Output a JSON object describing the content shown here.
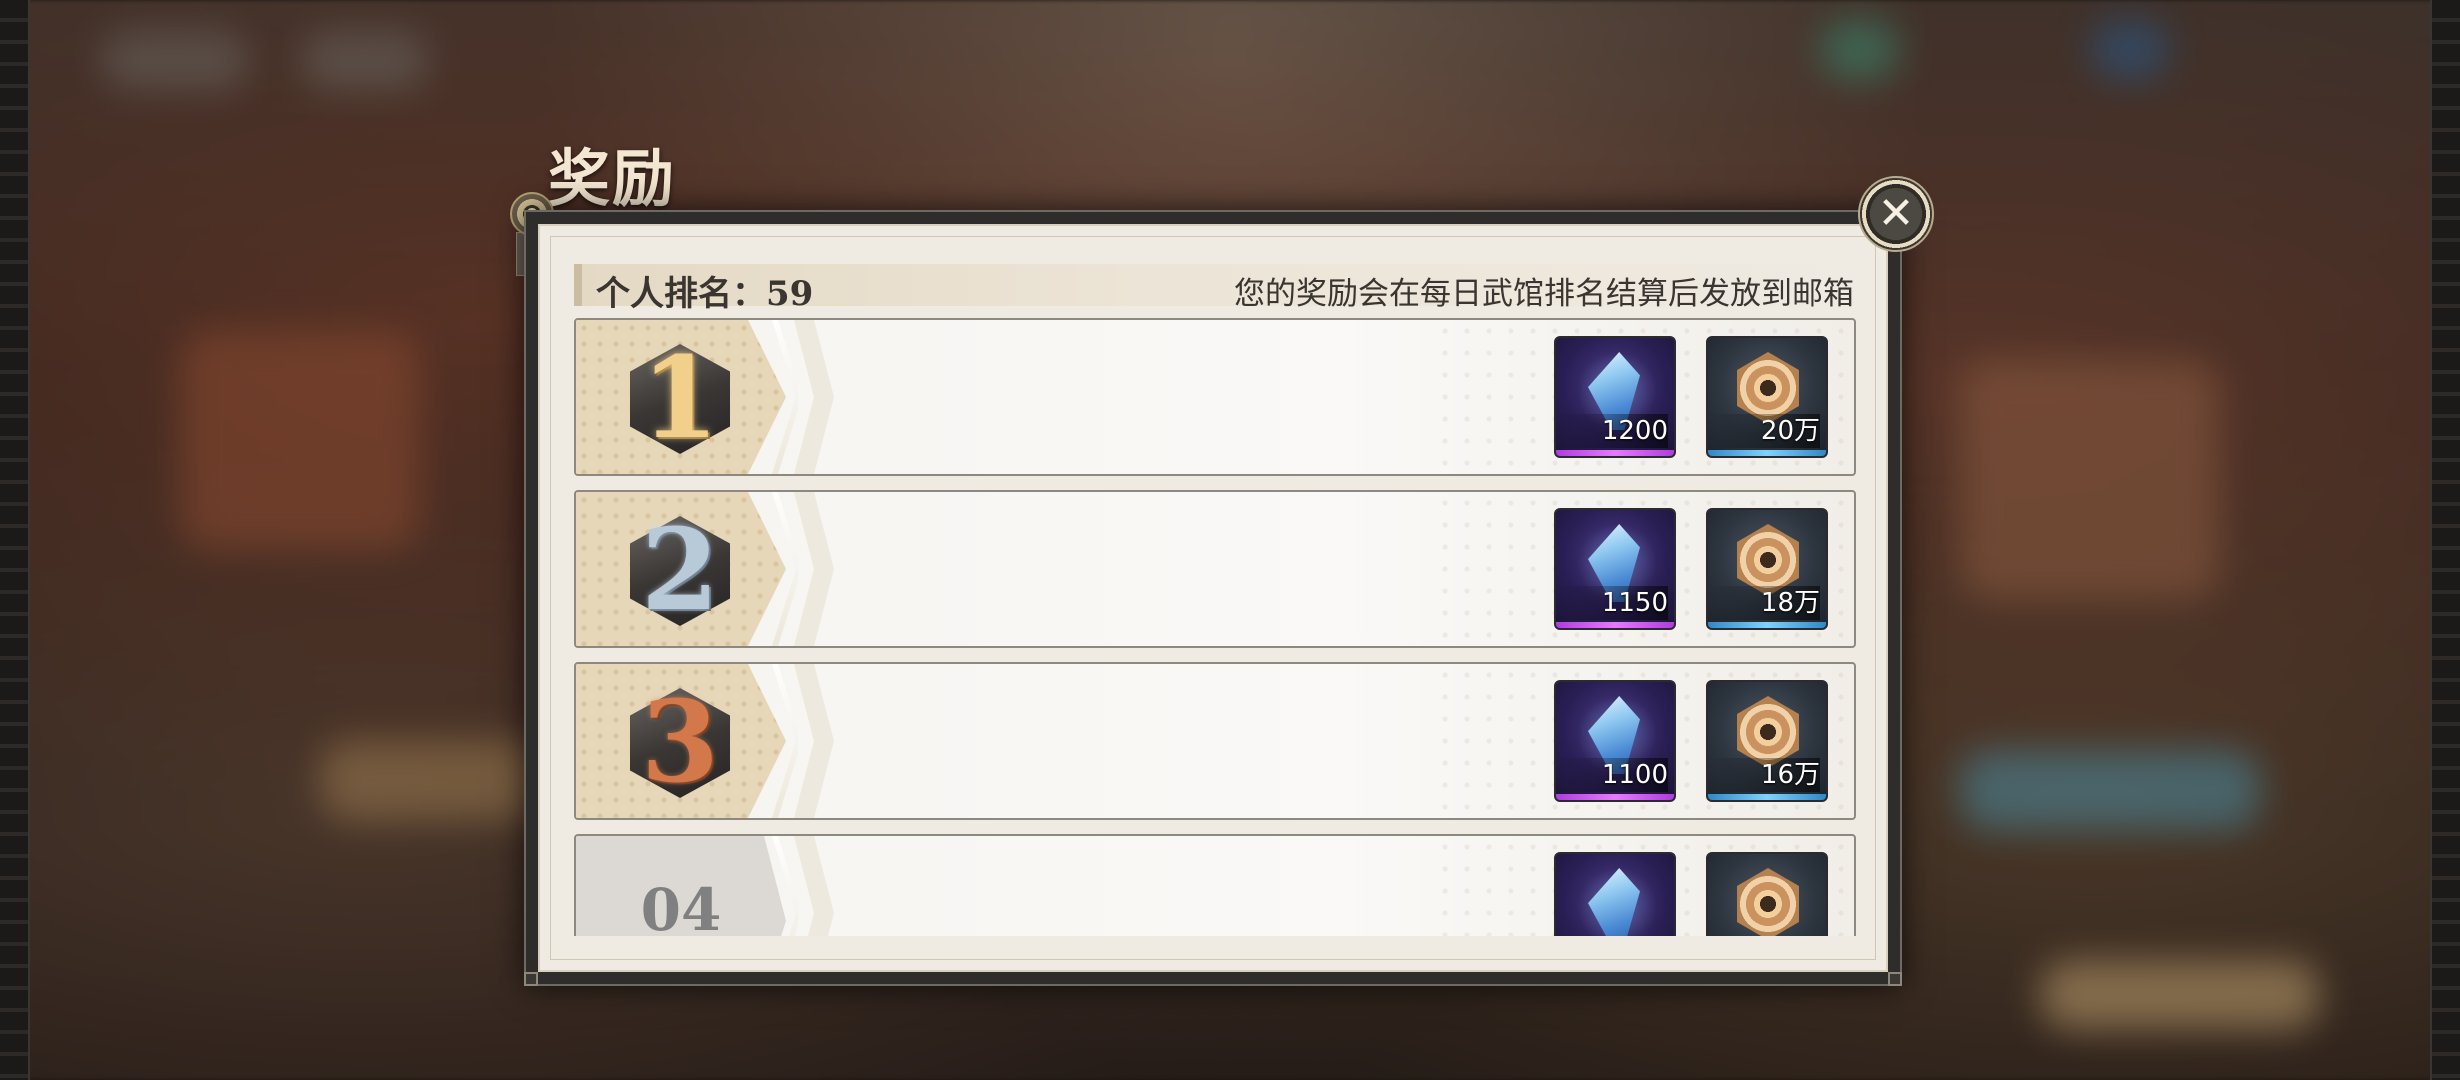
{
  "dialog": {
    "title": "奖励",
    "close_icon": "close-icon"
  },
  "header": {
    "rank_label": "个人排名：59",
    "note": "您的奖励会在每日武馆排名结算后发放到邮箱"
  },
  "rewards": [
    {
      "rank": "1",
      "medal": "gold",
      "items": [
        {
          "icon": "feather-crystal-icon",
          "qty": "1200"
        },
        {
          "icon": "gold-coin-icon",
          "qty": "20万"
        }
      ]
    },
    {
      "rank": "2",
      "medal": "silver",
      "items": [
        {
          "icon": "feather-crystal-icon",
          "qty": "1150"
        },
        {
          "icon": "gold-coin-icon",
          "qty": "18万"
        }
      ]
    },
    {
      "rank": "3",
      "medal": "bronze",
      "items": [
        {
          "icon": "feather-crystal-icon",
          "qty": "1100"
        },
        {
          "icon": "gold-coin-icon",
          "qty": "16万"
        }
      ]
    },
    {
      "rank": "04",
      "medal": "none",
      "items": [
        {
          "icon": "feather-crystal-icon",
          "qty": ""
        },
        {
          "icon": "gold-coin-icon",
          "qty": ""
        }
      ]
    }
  ]
}
